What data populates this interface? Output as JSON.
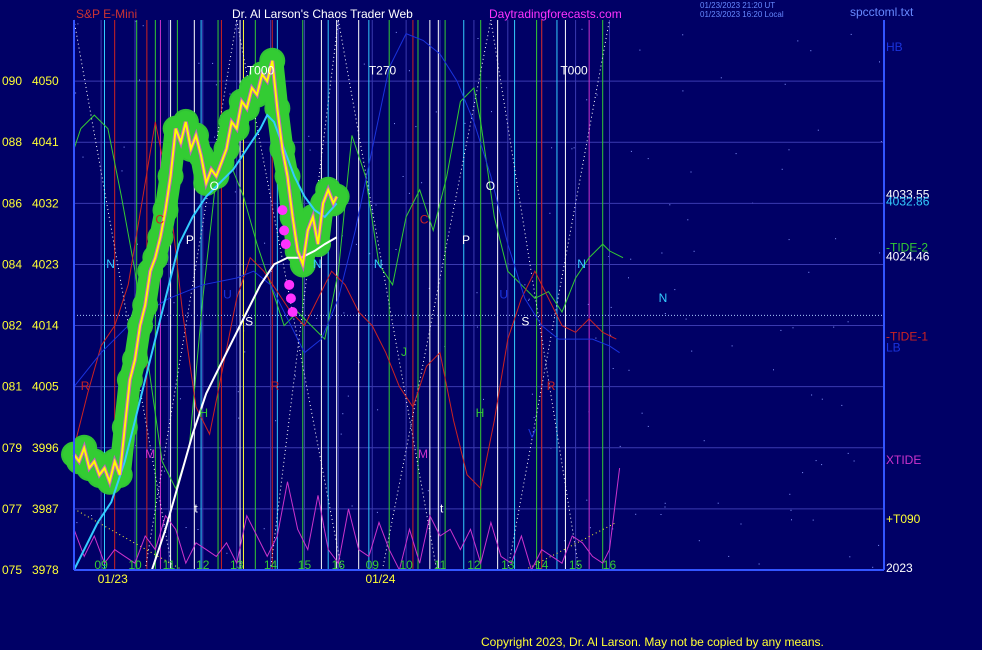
{
  "header": {
    "symbol": "S&P E-Mini",
    "title": "Dr. Al Larson's Chaos Trader Web",
    "site": "Daytradingforecasts.com",
    "stamp_line1": "01/23/2023 21:20 UT",
    "stamp_line2": "01/23/2023 16:20 Local",
    "file": "spcctoml.txt"
  },
  "footer": {
    "copyright": "Copyright 2023, Dr. Al Larson. May not be copied by any means."
  },
  "colors": {
    "background": "#000066",
    "grid": "#3a3ab0",
    "price": "#ffff00",
    "band": "#33cc33",
    "marker": "#ff33ff",
    "ema_fast": "#33ccff",
    "ema_slow": "#ffffff",
    "tide_green": "#33cc33",
    "tide_red": "#cc2222",
    "xtide": "#cc33cc",
    "blue_line": "#1a33dd",
    "axis_text": "#ffff33",
    "red_text": "#cc3333"
  },
  "chart_data": {
    "type": "line",
    "title": "S&P E-Mini",
    "ylabel": "",
    "ylim": [
      3978,
      4059
    ],
    "y_ticks": [
      {
        "left": "075",
        "right": "3978",
        "value": 3978
      },
      {
        "left": "077",
        "right": "3987",
        "value": 3987
      },
      {
        "left": "079",
        "right": "3996",
        "value": 3996
      },
      {
        "left": "081",
        "right": "4005",
        "value": 4005
      },
      {
        "left": "082",
        "right": "4014",
        "value": 4014
      },
      {
        "left": "084",
        "right": "4023",
        "value": 4023
      },
      {
        "left": "086",
        "right": "4032",
        "value": 4032
      },
      {
        "left": "088",
        "right": "4041",
        "value": 4041
      },
      {
        "left": "090",
        "right": "4050",
        "value": 4050
      }
    ],
    "xlim": [
      8.2,
      32.1
    ],
    "x_ticks": [
      {
        "label": "09",
        "x": 9
      },
      {
        "label": "10",
        "x": 10
      },
      {
        "label": "11",
        "x": 11
      },
      {
        "label": "12",
        "x": 12
      },
      {
        "label": "13",
        "x": 13
      },
      {
        "label": "14",
        "x": 14
      },
      {
        "label": "15",
        "x": 15
      },
      {
        "label": "16",
        "x": 16
      },
      {
        "label": "09",
        "x": 17
      },
      {
        "label": "10",
        "x": 18
      },
      {
        "label": "11",
        "x": 19
      },
      {
        "label": "12",
        "x": 20
      },
      {
        "label": "13",
        "x": 21
      },
      {
        "label": "14",
        "x": 22
      },
      {
        "label": "15",
        "x": 23
      },
      {
        "label": "16",
        "x": 24
      }
    ],
    "date_labels": [
      {
        "label": "01/23",
        "x": 8.9
      },
      {
        "label": "01/24",
        "x": 16.8
      }
    ],
    "grid": true,
    "series": [
      {
        "name": "",
        "role": "price",
        "x": [
          8.2,
          8.35,
          8.5,
          8.65,
          8.8,
          8.95,
          9.1,
          9.25,
          9.4,
          9.55,
          9.7,
          9.85,
          10,
          10.15,
          10.3,
          10.45,
          10.6,
          10.75,
          10.9,
          11.05,
          11.2,
          11.35,
          11.5,
          11.65,
          11.8,
          11.95,
          12.1,
          12.25,
          12.4,
          12.55,
          12.7,
          12.85,
          13,
          13.15,
          13.3,
          13.45,
          13.6,
          13.75,
          13.9,
          14.05,
          14.2,
          14.35,
          14.5,
          14.65,
          14.8,
          14.95,
          15.1,
          15.25,
          15.4,
          15.55,
          15.7,
          15.85,
          15.95
        ],
        "y": [
          3995,
          3994,
          3996,
          3993,
          3994,
          3992,
          3993,
          3991,
          3994,
          3992,
          3999,
          4006,
          4009,
          4014,
          4017,
          4022,
          4024,
          4027,
          4031,
          4036,
          4043,
          4041,
          4044,
          4040,
          4042,
          4039,
          4035,
          4037,
          4036,
          4038,
          4040,
          4044,
          4043,
          4047,
          4046,
          4049,
          4048,
          4051,
          4050,
          4053,
          4046,
          4040,
          4036,
          4030,
          4025,
          4023,
          4028,
          4030,
          4026,
          4032,
          4034,
          4032,
          4033
        ]
      },
      {
        "name": "",
        "role": "ema_fast",
        "x": [
          8.2,
          8.5,
          8.9,
          9.3,
          9.7,
          10.1,
          10.5,
          10.9,
          11.3,
          11.7,
          12.1,
          12.5,
          12.9,
          13.3,
          13.7,
          13.9,
          14.1,
          14.4,
          14.7,
          15,
          15.3,
          15.6,
          15.95
        ],
        "y": [
          3978,
          3981,
          3985,
          3988,
          3994,
          4002,
          4010,
          4018,
          4026,
          4030,
          4033,
          4035,
          4037,
          4040,
          4043,
          4045,
          4044,
          4040,
          4036,
          4033,
          4031,
          4030,
          4032
        ]
      },
      {
        "name": "",
        "role": "ema_slow",
        "x": [
          10.5,
          10.9,
          11.3,
          11.7,
          12.1,
          12.5,
          12.9,
          13.3,
          13.7,
          14.1,
          14.5,
          14.9,
          15.3,
          15.6,
          15.95
        ],
        "y": [
          3978,
          3984,
          3991,
          3998,
          4004,
          4008,
          4012,
          4016,
          4020,
          4023,
          4024,
          4024,
          4025,
          4026,
          4027
        ]
      },
      {
        "name": "TIDE-2",
        "role": "tide2",
        "x": [
          8.2,
          8.4,
          8.8,
          9.2,
          9.6,
          10,
          10.4,
          10.8,
          11.2,
          11.6,
          12,
          12.4,
          12.8,
          13.2,
          13.6,
          14,
          14.4,
          14.8,
          15.2,
          15.6,
          16,
          16.4,
          16.8,
          17.2,
          17.6,
          18,
          18.4,
          18.8,
          19.2,
          19.6,
          20,
          20.2,
          20.6,
          21,
          21.4,
          21.8,
          22.2,
          22.6,
          23,
          23.4,
          23.8,
          24,
          24.4
        ],
        "y": [
          4040,
          4043,
          4045,
          4043,
          4033,
          4022,
          4008,
          3994,
          3990,
          3996,
          4018,
          4036,
          4038,
          4033,
          4026,
          4020,
          4014,
          4016,
          4014,
          4012,
          4022,
          4042,
          4036,
          4023,
          4020,
          4030,
          4034,
          4028,
          4036,
          4047,
          4049,
          4044,
          4030,
          4022,
          4020,
          4018,
          4019,
          4016,
          4021,
          4024,
          4026,
          4025,
          4024
        ]
      },
      {
        "name": "TIDE-1",
        "role": "tide1",
        "x": [
          8.2,
          8.6,
          9,
          9.4,
          9.8,
          10.2,
          10.6,
          11,
          11.4,
          11.8,
          12.2,
          12.6,
          13,
          13.4,
          13.8,
          14.2,
          14.6,
          15,
          15.4,
          15.8,
          16.2,
          16.6,
          17,
          17.4,
          17.8,
          18.2,
          18.6,
          19,
          19.4,
          19.8,
          20.2,
          20.6,
          21,
          21.4,
          21.8,
          22.2,
          22.6,
          23,
          23.4,
          23.8,
          24.2
        ],
        "y": [
          3996,
          4004,
          4011,
          4014,
          4020,
          4032,
          4044,
          4034,
          4016,
          4002,
          3998,
          4008,
          4018,
          4024,
          4022,
          4019,
          4016,
          4014,
          4018,
          4022,
          4020,
          4016,
          4014,
          4010,
          4005,
          4002,
          4008,
          4010,
          4000,
          3992,
          3990,
          4000,
          4012,
          4018,
          4022,
          4018,
          4014,
          4013,
          4015,
          4013,
          4012
        ]
      },
      {
        "name": "XTIDE",
        "role": "xtide",
        "x": [
          8.2,
          8.5,
          8.8,
          9.1,
          9.4,
          9.7,
          10,
          10.3,
          10.6,
          10.9,
          11.2,
          11.5,
          11.8,
          12.1,
          12.4,
          12.7,
          13,
          13.3,
          13.6,
          13.9,
          14.2,
          14.5,
          14.8,
          15.1,
          15.4,
          15.7,
          16,
          16.3,
          16.6,
          16.9,
          17.2,
          17.5,
          17.8,
          18.1,
          18.4,
          18.7,
          19,
          19.3,
          19.6,
          19.9,
          20.2,
          20.5,
          20.8,
          21.1,
          21.4,
          21.7,
          22,
          22.3,
          22.6,
          22.9,
          23.2,
          23.5,
          23.8,
          24,
          24.3
        ],
        "y": [
          3984,
          3980,
          3983,
          3979,
          3981,
          3980,
          3979,
          3983,
          3981,
          3986,
          3984,
          3979,
          3982,
          3981,
          3980,
          3982,
          3979,
          3986,
          3983,
          3980,
          3983,
          3991,
          3984,
          3981,
          3989,
          3981,
          3979,
          3987,
          3981,
          3980,
          3985,
          3981,
          3978,
          3984,
          3979,
          3986,
          3983,
          3984,
          3981,
          3984,
          3979,
          3985,
          3980,
          3979,
          3983,
          3978,
          3981,
          3980,
          3979,
          3983,
          3982,
          3980,
          3979,
          3981,
          3993
        ]
      },
      {
        "name": "",
        "role": "blue_line",
        "x": [
          8.2,
          9,
          10,
          11,
          12,
          13,
          13.5,
          14,
          14.5,
          15,
          15.5,
          16,
          16.5,
          17,
          17.5,
          18,
          18.5,
          19,
          19.5,
          20,
          20.5,
          21,
          21.5,
          22,
          22.5,
          23,
          23.5,
          24,
          24.3
        ],
        "y": [
          4005,
          4010,
          4015,
          4018,
          4020,
          4021,
          4022,
          4020,
          4015,
          4010,
          4012,
          4018,
          4028,
          4040,
          4052,
          4057,
          4056,
          4054,
          4050,
          4044,
          4036,
          4026,
          4018,
          4014,
          4012,
          4012,
          4012,
          4011,
          4010
        ]
      }
    ],
    "magenta_markers": [
      {
        "x": 14.35,
        "y": 4031
      },
      {
        "x": 14.4,
        "y": 4028
      },
      {
        "x": 14.45,
        "y": 4026
      },
      {
        "x": 14.55,
        "y": 4020
      },
      {
        "x": 14.6,
        "y": 4018
      },
      {
        "x": 14.65,
        "y": 4016
      }
    ],
    "hline": {
      "y": 4015.5
    },
    "vlines": [
      {
        "x": 8.2,
        "c": "#33cc33"
      },
      {
        "x": 9.1,
        "c": "#33ccff"
      },
      {
        "x": 9.4,
        "c": "#cc2222"
      },
      {
        "x": 10.05,
        "c": "#33cc33"
      },
      {
        "x": 10.35,
        "c": "#cc2222"
      },
      {
        "x": 10.6,
        "c": "#33cc33"
      },
      {
        "x": 10.75,
        "c": "#cc33cc"
      },
      {
        "x": 11.05,
        "c": "#ffffff"
      },
      {
        "x": 11.25,
        "c": "#33cc33"
      },
      {
        "x": 11.75,
        "c": "#ffffff"
      },
      {
        "x": 11.95,
        "c": "#33ccff"
      },
      {
        "x": 12.45,
        "c": "#33cc33"
      },
      {
        "x": 12.55,
        "c": "#cc2222"
      },
      {
        "x": 13.1,
        "c": "#ffffff"
      },
      {
        "x": 13.2,
        "c": "#ffff33"
      },
      {
        "x": 13.55,
        "c": "#33cc33"
      },
      {
        "x": 14.05,
        "c": "#cc2222"
      },
      {
        "x": 14.2,
        "c": "#33ccff"
      },
      {
        "x": 14.95,
        "c": "#33cc33"
      },
      {
        "x": 15.5,
        "c": "#ffffff"
      },
      {
        "x": 15.7,
        "c": "#33ccff"
      },
      {
        "x": 15.95,
        "c": "#ffffff"
      },
      {
        "x": 16.6,
        "c": "#ffffff"
      },
      {
        "x": 16.9,
        "c": "#33ccff"
      },
      {
        "x": 17.5,
        "c": "#33cc33"
      },
      {
        "x": 18.2,
        "c": "#cc2222"
      },
      {
        "x": 18.35,
        "c": "#33cc33"
      },
      {
        "x": 18.7,
        "c": "#ffffff"
      },
      {
        "x": 18.95,
        "c": "#ffffff"
      },
      {
        "x": 19.15,
        "c": "#33cc33"
      },
      {
        "x": 19.7,
        "c": "#33ccff"
      },
      {
        "x": 20.2,
        "c": "#33cc33"
      },
      {
        "x": 20.7,
        "c": "#ffffff"
      },
      {
        "x": 21.2,
        "c": "#33ccff"
      },
      {
        "x": 21.85,
        "c": "#33cc33"
      },
      {
        "x": 22.0,
        "c": "#cc2222"
      },
      {
        "x": 22.45,
        "c": "#33ccff"
      },
      {
        "x": 22.7,
        "c": "#ffffff"
      },
      {
        "x": 23.4,
        "c": "#cc33cc"
      },
      {
        "x": 23.8,
        "c": "#33cc33"
      }
    ],
    "dotted_lines": [
      {
        "x1": 8.2,
        "y1": 4059,
        "x2": 11.1,
        "y2": 3978,
        "c": "#ffffff"
      },
      {
        "x1": 10.3,
        "y1": 3978,
        "x2": 13.0,
        "y2": 4059,
        "c": "#ffffff"
      },
      {
        "x1": 13.0,
        "y1": 4059,
        "x2": 16.1,
        "y2": 3978,
        "c": "#ffffff"
      },
      {
        "x1": 14.0,
        "y1": 3978,
        "x2": 16.0,
        "y2": 4059,
        "c": "#ffffff"
      },
      {
        "x1": 16.0,
        "y1": 4059,
        "x2": 18.9,
        "y2": 3978,
        "c": "#ffffff"
      },
      {
        "x1": 17.3,
        "y1": 3978,
        "x2": 20.5,
        "y2": 4059,
        "c": "#ffffff"
      },
      {
        "x1": 20.5,
        "y1": 4059,
        "x2": 23.1,
        "y2": 3978,
        "c": "#ffffff"
      },
      {
        "x1": 21.0,
        "y1": 3978,
        "x2": 24.0,
        "y2": 4059,
        "c": "#ffffff"
      },
      {
        "x1": 8.2,
        "y1": 3987,
        "x2": 11.4,
        "y2": 3978,
        "c": "#ffff33"
      },
      {
        "x1": 21.5,
        "y1": 3978,
        "x2": 24.2,
        "y2": 3985,
        "c": "#ffff33"
      }
    ],
    "annotations": [
      {
        "text": "T000",
        "x": 13.3,
        "y": 4051,
        "c": "#ffffff"
      },
      {
        "text": "T270",
        "x": 16.9,
        "y": 4051,
        "c": "#ffffff"
      },
      {
        "text": "T000",
        "x": 22.55,
        "y": 4051,
        "c": "#ffffff"
      },
      {
        "text": "N",
        "x": 9.15,
        "y": 4022.5,
        "c": "#33ccff"
      },
      {
        "text": "N",
        "x": 15.25,
        "y": 4022.5,
        "c": "#33ccff"
      },
      {
        "text": "N",
        "x": 17.05,
        "y": 4022.5,
        "c": "#33ccff"
      },
      {
        "text": "N",
        "x": 23.05,
        "y": 4022.5,
        "c": "#33ccff"
      },
      {
        "text": "N",
        "x": 25.45,
        "y": 4017.5,
        "c": "#33ccff"
      },
      {
        "text": "O",
        "x": 12.2,
        "y": 4034,
        "c": "#ffffff"
      },
      {
        "text": "O",
        "x": 20.35,
        "y": 4034,
        "c": "#ffffff"
      },
      {
        "text": "P",
        "x": 11.5,
        "y": 4026,
        "c": "#ffffff"
      },
      {
        "text": "P",
        "x": 19.65,
        "y": 4026,
        "c": "#ffffff"
      },
      {
        "text": "S",
        "x": 13.25,
        "y": 4014,
        "c": "#ffffff"
      },
      {
        "text": "S",
        "x": 21.4,
        "y": 4014,
        "c": "#ffffff"
      },
      {
        "text": "U",
        "x": 12.6,
        "y": 4018,
        "c": "#1a33dd"
      },
      {
        "text": "U",
        "x": 20.75,
        "y": 4018,
        "c": "#1a33dd"
      },
      {
        "text": "R",
        "x": 8.4,
        "y": 4004.5,
        "c": "#cc2222"
      },
      {
        "text": "R",
        "x": 14.0,
        "y": 4004.5,
        "c": "#cc2222"
      },
      {
        "text": "R",
        "x": 22.15,
        "y": 4004.5,
        "c": "#cc2222"
      },
      {
        "text": "M",
        "x": 10.3,
        "y": 3994.5,
        "c": "#cc33cc"
      },
      {
        "text": "M",
        "x": 18.35,
        "y": 3994.5,
        "c": "#cc33cc"
      },
      {
        "text": "H",
        "x": 11.9,
        "y": 4000.5,
        "c": "#33cc33"
      },
      {
        "text": "H",
        "x": 20.05,
        "y": 4000.5,
        "c": "#33cc33"
      },
      {
        "text": "J",
        "x": 17.85,
        "y": 4009.5,
        "c": "#33cc33"
      },
      {
        "text": "C",
        "x": 10.6,
        "y": 4029,
        "c": "#cc2222"
      },
      {
        "text": "C",
        "x": 18.4,
        "y": 4029,
        "c": "#cc2222"
      },
      {
        "text": "V",
        "x": 21.6,
        "y": 3997.5,
        "c": "#1a33dd"
      },
      {
        "text": "t",
        "x": 11.75,
        "y": 3986.5,
        "c": "#ffffff"
      },
      {
        "text": "t",
        "x": 19.0,
        "y": 3986.5,
        "c": "#ffffff"
      }
    ],
    "right_labels": [
      {
        "text": "HB",
        "y": 4055,
        "c": "#1a33dd"
      },
      {
        "text": "4033.55",
        "y": 4033.3,
        "c": "#ffffff"
      },
      {
        "text": "4032.86",
        "y": 4032.3,
        "c": "#33ccff"
      },
      {
        "text": "-TIDE-2",
        "y": 4025.5,
        "c": "#33cc33"
      },
      {
        "text": "4024.46",
        "y": 4024.2,
        "c": "#ffffff"
      },
      {
        "text": "-TIDE-1",
        "y": 4012.4,
        "c": "#cc2222"
      },
      {
        "text": "LB",
        "y": 4010.8,
        "c": "#1a33dd"
      },
      {
        "text": "XTIDE",
        "y": 3994.2,
        "c": "#cc33cc"
      },
      {
        "text": "+T090",
        "y": 3985.5,
        "c": "#ffff33"
      },
      {
        "text": "2023",
        "y": 3978.3,
        "c": "#ffffff"
      }
    ]
  }
}
